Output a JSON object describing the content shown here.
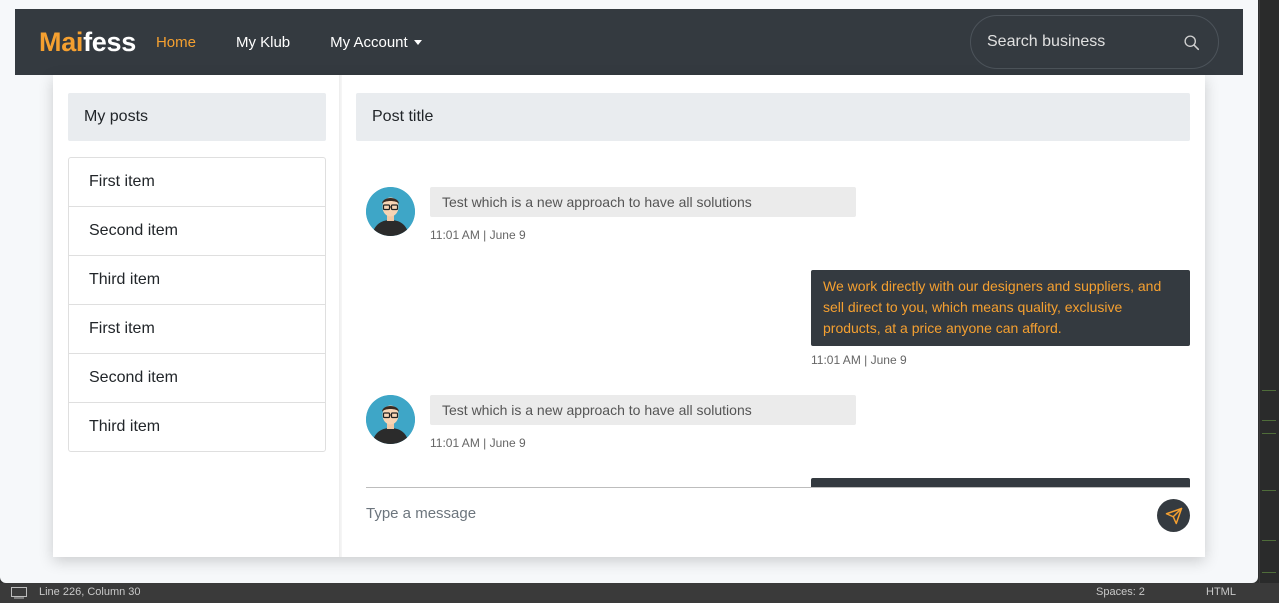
{
  "navbar": {
    "brand_accent": "Mai",
    "brand_rest": "fess",
    "links": {
      "home": "Home",
      "klub": "My Klub",
      "account": "My Account"
    },
    "search_placeholder": "Search business"
  },
  "sidebar": {
    "title": "My posts",
    "items": [
      "First item",
      "Second item",
      "Third item",
      "First item",
      "Second item",
      "Third item"
    ]
  },
  "chat": {
    "title": "Post title",
    "messages": [
      {
        "direction": "incoming",
        "text": "Test which is a new approach to have all solutions",
        "time": "11:01 AM | June 9"
      },
      {
        "direction": "outgoing",
        "text": "We work directly with our designers and suppliers, and sell direct to you, which means quality, exclusive products, at a price anyone can afford.",
        "time": "11:01 AM | June 9"
      },
      {
        "direction": "incoming",
        "text": "Test which is a new approach to have all solutions",
        "time": "11:01 AM | June 9"
      }
    ],
    "composer_placeholder": "Type a message"
  },
  "statusbar": {
    "position": "Line 226, Column 30",
    "spaces": "Spaces: 2",
    "language": "HTML"
  },
  "colors": {
    "navbar": "#343a40",
    "accent": "#f5a030",
    "panel_header": "#e9ecef"
  },
  "icons": [
    "search-icon",
    "caret-down-icon",
    "avatar-icon",
    "send-icon",
    "monitor-icon"
  ]
}
